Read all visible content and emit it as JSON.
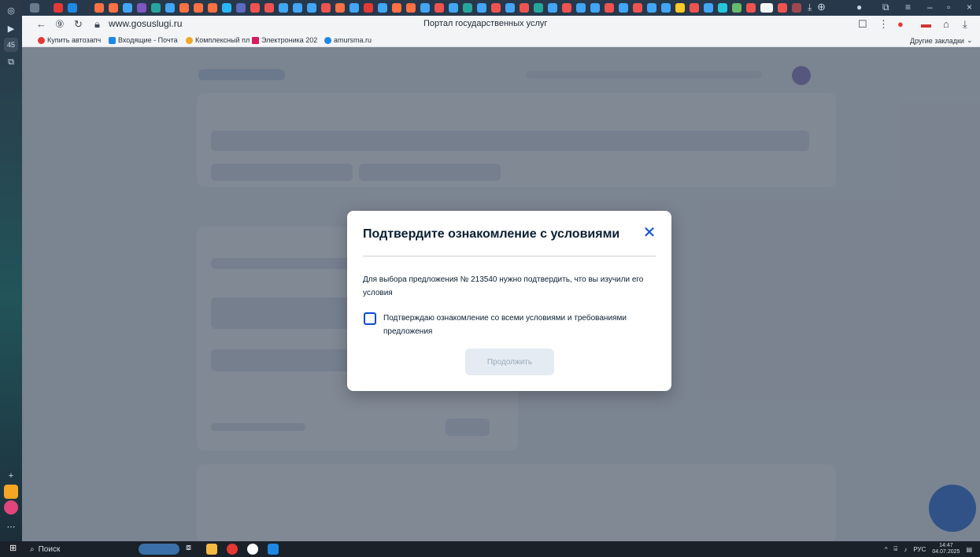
{
  "browser": {
    "url": "www.gosuslugi.ru",
    "page_title": "Портал государственных услуг",
    "sidebar_badge": "45",
    "bookmarks": [
      {
        "label": "Купить автозапч",
        "color": "#e53935"
      },
      {
        "label": "Входящие - Почта",
        "color": "#1e88e5"
      },
      {
        "label": "Комплексный пл",
        "color": "#f5a623"
      },
      {
        "label": "Электроника 202",
        "color": "#d81b60"
      },
      {
        "label": "amursma.ru",
        "color": "#1e88e5"
      }
    ],
    "other_bookmarks": "Другие закладки"
  },
  "modal": {
    "title": "Подтвердите ознакомление с условиями",
    "description": "Для выбора предложения № 213540 нужно подтвердить, что вы изучили его условия",
    "checkbox_label": "Подтверждаю ознакомление со всеми условиями и требованиями предложения",
    "checkbox_checked": false,
    "continue_label": "Продолжить",
    "accent": "#0d4cd3"
  },
  "taskbar": {
    "search_placeholder": "Поиск",
    "language": "РУС",
    "time": "14:47",
    "date": "04.07.2025"
  }
}
